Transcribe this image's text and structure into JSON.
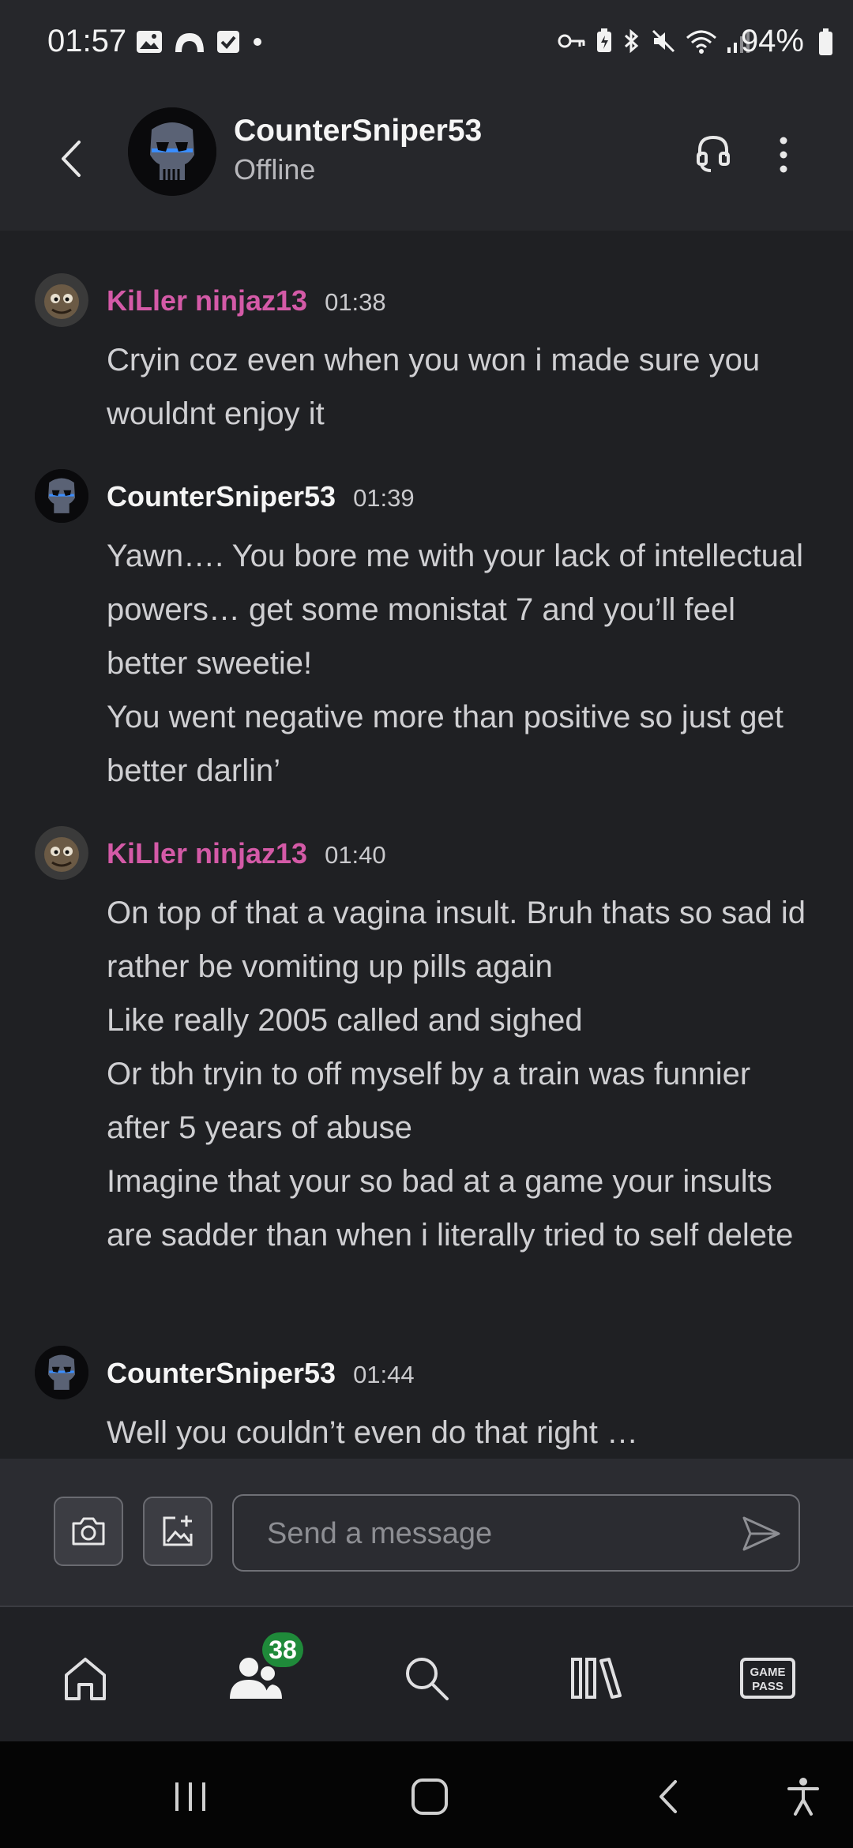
{
  "status_bar": {
    "time": "01:57",
    "battery": "94%",
    "left_icons": [
      "gallery-icon",
      "cloud-icon",
      "checkbox-icon",
      "dot-icon"
    ],
    "right_icons": [
      "key-icon",
      "battery-saver-icon",
      "bluetooth-icon",
      "mute-icon",
      "wifi-icon",
      "signal-icon"
    ]
  },
  "header": {
    "name": "CounterSniper53",
    "status": "Offline"
  },
  "messages": [
    {
      "author": "KiLler ninjaz13",
      "time": "01:38",
      "lines": [
        "Cryin coz even when you won i made sure you wouldnt enjoy it"
      ]
    },
    {
      "author": "CounterSniper53",
      "time": "01:39",
      "lines": [
        "Yawn…. You bore me with your lack of intellectual powers… get some monistat 7 and you’ll feel better sweetie!",
        "You went negative more than positive so just get better darlin’"
      ]
    },
    {
      "author": "KiLler ninjaz13",
      "time": "01:40",
      "lines": [
        "On top of that a vagina insult. Bruh thats so sad id rather be vomiting up pills again",
        "Like really 2005 called and sighed",
        "Or tbh tryin to off myself by a train was funnier after 5 years of abuse",
        "Imagine that your so bad at a game your insults are sadder than when i literally tried to self delete"
      ]
    },
    {
      "author": "CounterSniper53",
      "time": "01:44",
      "lines": [
        "Well you couldn’t even do that right …"
      ]
    }
  ],
  "composer": {
    "placeholder": "Send a message"
  },
  "bottom_nav": {
    "friends_badge": "38",
    "items": [
      "home-icon",
      "friends-icon",
      "search-icon",
      "library-icon",
      "game-pass-icon"
    ],
    "game_pass_line1": "GAME",
    "game_pass_line2": "PASS"
  },
  "colors": {
    "background": "#1f2023",
    "header": "#26272b",
    "author_pink": "#d45aa7",
    "badge_green": "#1f8a3a"
  }
}
